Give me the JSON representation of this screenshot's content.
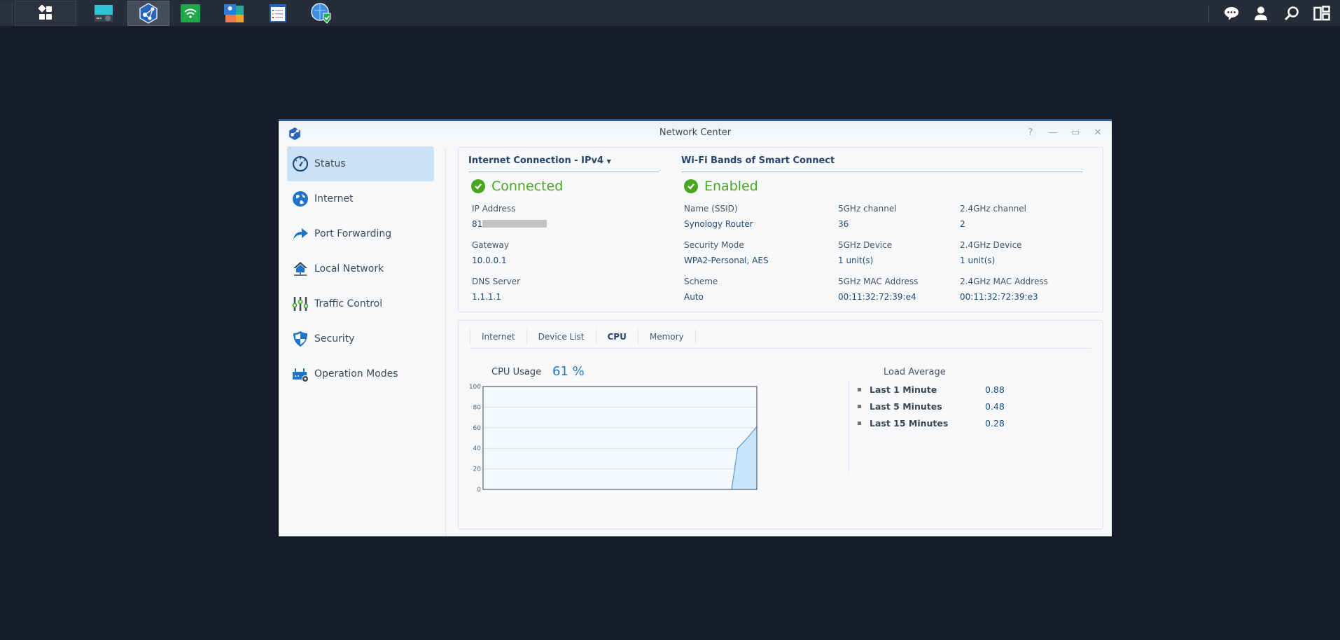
{
  "taskbar": {
    "apps": [
      "main-menu",
      "storage-manager",
      "network-center",
      "wifi-connect",
      "user-management",
      "log-center",
      "safe-access"
    ],
    "right_icons": [
      "chat-icon",
      "user-icon",
      "search-icon",
      "widgets-icon"
    ]
  },
  "window": {
    "title": "Network Center",
    "controls": [
      "?",
      "—",
      "▭",
      "✕"
    ]
  },
  "sidebar": {
    "items": [
      {
        "label": "Status",
        "icon": "gauge-icon",
        "active": true
      },
      {
        "label": "Internet",
        "icon": "globe-icon"
      },
      {
        "label": "Port Forwarding",
        "icon": "arrow-forward-icon"
      },
      {
        "label": "Local Network",
        "icon": "home-network-icon"
      },
      {
        "label": "Traffic Control",
        "icon": "sliders-icon"
      },
      {
        "label": "Security",
        "icon": "shield-icon"
      },
      {
        "label": "Operation Modes",
        "icon": "router-gear-icon"
      }
    ]
  },
  "internet": {
    "heading": "Internet Connection - ",
    "protocol": "IPv4",
    "status": "Connected",
    "fields": [
      {
        "label": "IP Address",
        "value": "81"
      },
      {
        "label": "Gateway",
        "value": "10.0.0.1"
      },
      {
        "label": "DNS Server",
        "value": "1.1.1.1"
      }
    ]
  },
  "wifi": {
    "heading": "Wi-Fi Bands of Smart Connect",
    "status": "Enabled",
    "col1": [
      {
        "label": "Name (SSID)",
        "value": "Synology Router"
      },
      {
        "label": "Security Mode",
        "value": "WPA2-Personal, AES"
      },
      {
        "label": "Scheme",
        "value": "Auto"
      }
    ],
    "col2": [
      {
        "label": "5GHz channel",
        "value": "36"
      },
      {
        "label": "5GHz Device",
        "value": "1 unit(s)"
      },
      {
        "label": "5GHz MAC Address",
        "value": "00:11:32:72:39:e4"
      }
    ],
    "col3": [
      {
        "label": "2.4GHz channel",
        "value": "2"
      },
      {
        "label": "2.4GHz Device",
        "value": "1 unit(s)"
      },
      {
        "label": "2.4GHz MAC Address",
        "value": "00:11:32:72:39:e3"
      }
    ]
  },
  "tabs": [
    {
      "label": "Internet"
    },
    {
      "label": "Device List"
    },
    {
      "label": "CPU",
      "active": true
    },
    {
      "label": "Memory"
    }
  ],
  "cpu": {
    "label": "CPU Usage",
    "value": "61 %"
  },
  "load_average": {
    "title": "Load Average",
    "rows": [
      {
        "label": "Last 1 Minute",
        "value": "0.88"
      },
      {
        "label": "Last 5 Minutes",
        "value": "0.48"
      },
      {
        "label": "Last 15 Minutes",
        "value": "0.28"
      }
    ]
  },
  "colors": {
    "accent": "#2d5a91",
    "success": "#4aa521",
    "value_blue": "#1e78c8",
    "chart_fill": "#c6e5fa",
    "chart_line": "#5b9bd5"
  },
  "chart_data": {
    "type": "area",
    "title": "CPU Usage",
    "xlabel": "",
    "ylabel": "",
    "ylim": [
      0,
      100
    ],
    "yticks": [
      "0",
      "20",
      "40",
      "60",
      "80",
      "100"
    ],
    "grid": true,
    "x": [
      0,
      90.8,
      93,
      96.2,
      100
    ],
    "values": [
      0,
      0,
      40,
      49,
      61
    ]
  }
}
